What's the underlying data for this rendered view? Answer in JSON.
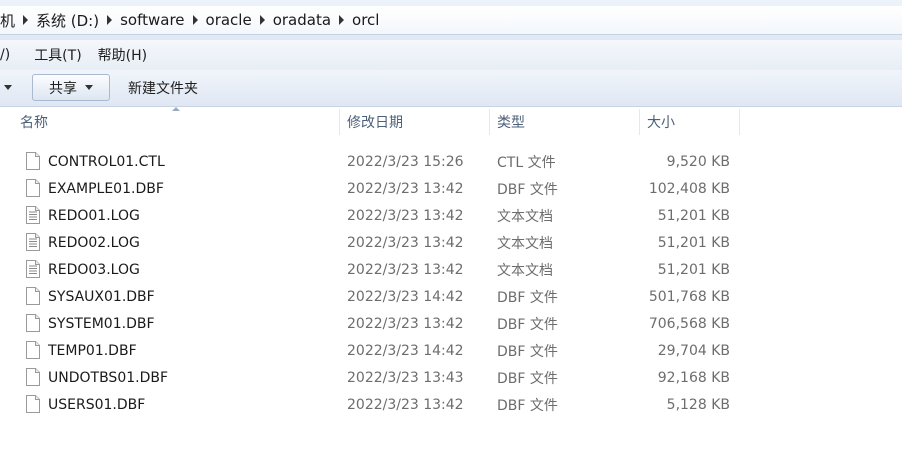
{
  "address": {
    "crumbs": [
      "机",
      "系统 (D:)",
      "software",
      "oracle",
      "oradata",
      "orcl"
    ]
  },
  "menu": {
    "items": [
      "/)",
      "工具(T)",
      "帮助(H)"
    ]
  },
  "toolbar": {
    "share_label": "共享",
    "new_folder_label": "新建文件夹"
  },
  "columns": {
    "name": "名称",
    "date": "修改日期",
    "type": "类型",
    "size": "大小"
  },
  "files": [
    {
      "name": "CONTROL01.CTL",
      "date": "2022/3/23 15:26",
      "type": "CTL 文件",
      "size": "9,520 KB",
      "icon": "blank-file-icon"
    },
    {
      "name": "EXAMPLE01.DBF",
      "date": "2022/3/23 13:42",
      "type": "DBF 文件",
      "size": "102,408 KB",
      "icon": "blank-file-icon"
    },
    {
      "name": "REDO01.LOG",
      "date": "2022/3/23 13:42",
      "type": "文本文档",
      "size": "51,201 KB",
      "icon": "text-file-icon"
    },
    {
      "name": "REDO02.LOG",
      "date": "2022/3/23 13:42",
      "type": "文本文档",
      "size": "51,201 KB",
      "icon": "text-file-icon"
    },
    {
      "name": "REDO03.LOG",
      "date": "2022/3/23 13:42",
      "type": "文本文档",
      "size": "51,201 KB",
      "icon": "text-file-icon"
    },
    {
      "name": "SYSAUX01.DBF",
      "date": "2022/3/23 14:42",
      "type": "DBF 文件",
      "size": "501,768 KB",
      "icon": "blank-file-icon"
    },
    {
      "name": "SYSTEM01.DBF",
      "date": "2022/3/23 13:42",
      "type": "DBF 文件",
      "size": "706,568 KB",
      "icon": "blank-file-icon"
    },
    {
      "name": "TEMP01.DBF",
      "date": "2022/3/23 14:42",
      "type": "DBF 文件",
      "size": "29,704 KB",
      "icon": "blank-file-icon"
    },
    {
      "name": "UNDOTBS01.DBF",
      "date": "2022/3/23 13:43",
      "type": "DBF 文件",
      "size": "92,168 KB",
      "icon": "blank-file-icon"
    },
    {
      "name": "USERS01.DBF",
      "date": "2022/3/23 13:42",
      "type": "DBF 文件",
      "size": "5,128 KB",
      "icon": "blank-file-icon"
    }
  ]
}
